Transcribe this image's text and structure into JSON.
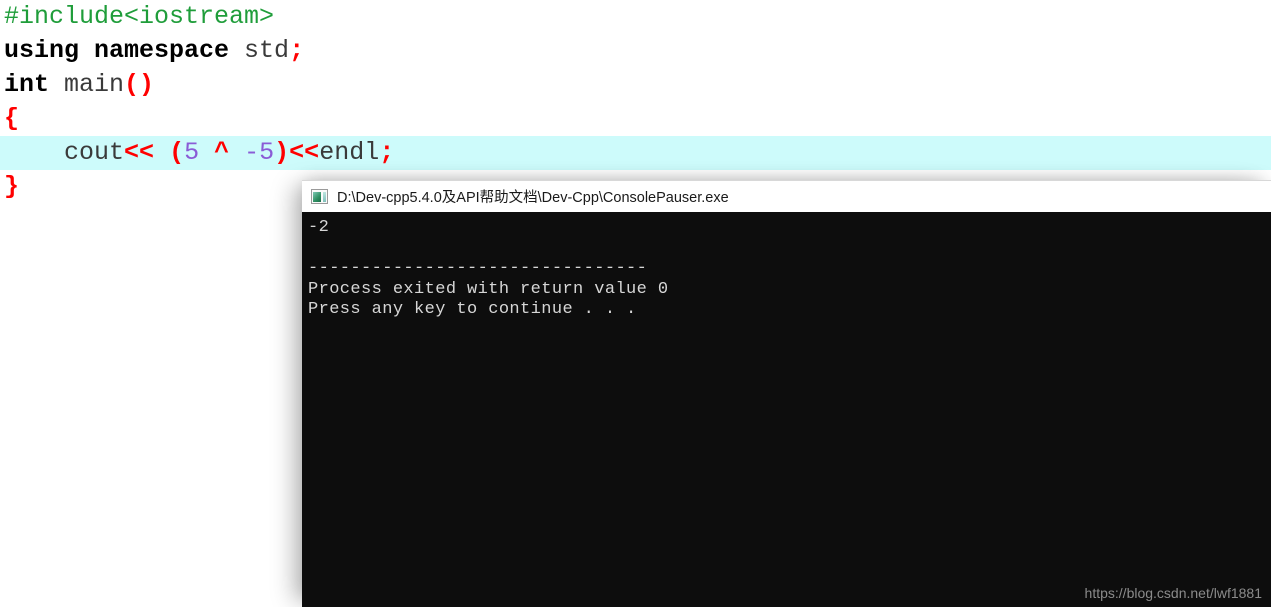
{
  "editor": {
    "name": "code-editor",
    "highlighted_line_index": 4,
    "lines": [
      {
        "id": "line-include",
        "tokens": [
          {
            "kind": "pre",
            "text": "#include<iostream>"
          }
        ]
      },
      {
        "id": "line-using",
        "tokens": [
          {
            "kind": "kw",
            "text": "using namespace"
          },
          {
            "kind": "id",
            "text": " std"
          },
          {
            "kind": "punct",
            "text": ";"
          }
        ]
      },
      {
        "id": "line-main",
        "tokens": [
          {
            "kind": "kw",
            "text": "int"
          },
          {
            "kind": "id",
            "text": " main"
          },
          {
            "kind": "punct",
            "text": "()"
          }
        ]
      },
      {
        "id": "line-open-brace",
        "tokens": [
          {
            "kind": "brace",
            "text": "{"
          }
        ]
      },
      {
        "id": "line-cout",
        "tokens": [
          {
            "kind": "id",
            "text": "    cout"
          },
          {
            "kind": "op",
            "text": "<<"
          },
          {
            "kind": "id",
            "text": " "
          },
          {
            "kind": "punct",
            "text": "("
          },
          {
            "kind": "num",
            "text": "5"
          },
          {
            "kind": "id",
            "text": " "
          },
          {
            "kind": "caret",
            "text": "^"
          },
          {
            "kind": "id",
            "text": " "
          },
          {
            "kind": "num",
            "text": "-5"
          },
          {
            "kind": "punct",
            "text": ")"
          },
          {
            "kind": "op",
            "text": "<<"
          },
          {
            "kind": "id",
            "text": "endl"
          },
          {
            "kind": "punct",
            "text": ";"
          }
        ]
      },
      {
        "id": "line-close-brace",
        "tokens": [
          {
            "kind": "brace",
            "text": "}"
          }
        ]
      }
    ]
  },
  "console": {
    "title": "D:\\Dev-cpp5.4.0及API帮助文档\\Dev-Cpp\\ConsolePauser.exe",
    "icon": "console-window-icon",
    "output_lines": [
      "-2",
      "",
      "--------------------------------",
      "Process exited with return value 0",
      "Press any key to continue . . ."
    ],
    "watermark": "https://blog.csdn.net/lwf1881"
  },
  "colors": {
    "highlight_line": "#cdfbfb",
    "preprocessor": "#1f9d3a",
    "keyword": "#000000",
    "punctuation": "#ff0000",
    "number": "#8a5cd6",
    "identifier": "#3a3a3a",
    "console_background": "#0d0d0d",
    "console_text": "#d6d6d6",
    "watermark": "#8b8b8b"
  }
}
